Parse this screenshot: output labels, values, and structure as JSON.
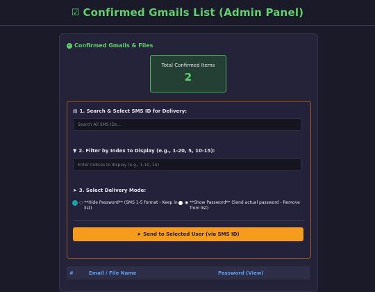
{
  "header": {
    "icon": "list-check-icon",
    "title": "Confirmed Gmails List (Admin Panel)"
  },
  "panel": {
    "section_title": "Confirmed Gmails & Files",
    "stat": {
      "label": "Total Confirmed Items",
      "value": "2"
    },
    "delivery": {
      "step1_label": "1. Search & Select SMS ID for Delivery:",
      "search_placeholder": "Search All SMS IDs...",
      "step2_label": "2. Filter by Index to Display (e.g., 1-20, 5, 10-15):",
      "filter_placeholder": "Enter indices to display (e.g., 1-10, 15)",
      "step3_label": "3. Select Delivery Mode:",
      "mode_options": [
        {
          "label": "**Hide Password** (SMS 1-5 format - Keep in list)",
          "selected": true
        },
        {
          "label": "**Show Password** (Send actual password - Remove from list)",
          "selected": false
        }
      ],
      "send_button": "Send to Selected User (via SMS ID)"
    },
    "table": {
      "columns": [
        "#",
        "Email / File Name",
        "Password (View)"
      ]
    }
  },
  "colors": {
    "accent_green": "#5fd06b",
    "accent_orange": "#f59c1a",
    "accent_blue": "#5a9ff0",
    "radio_teal": "#1aa3a3"
  }
}
